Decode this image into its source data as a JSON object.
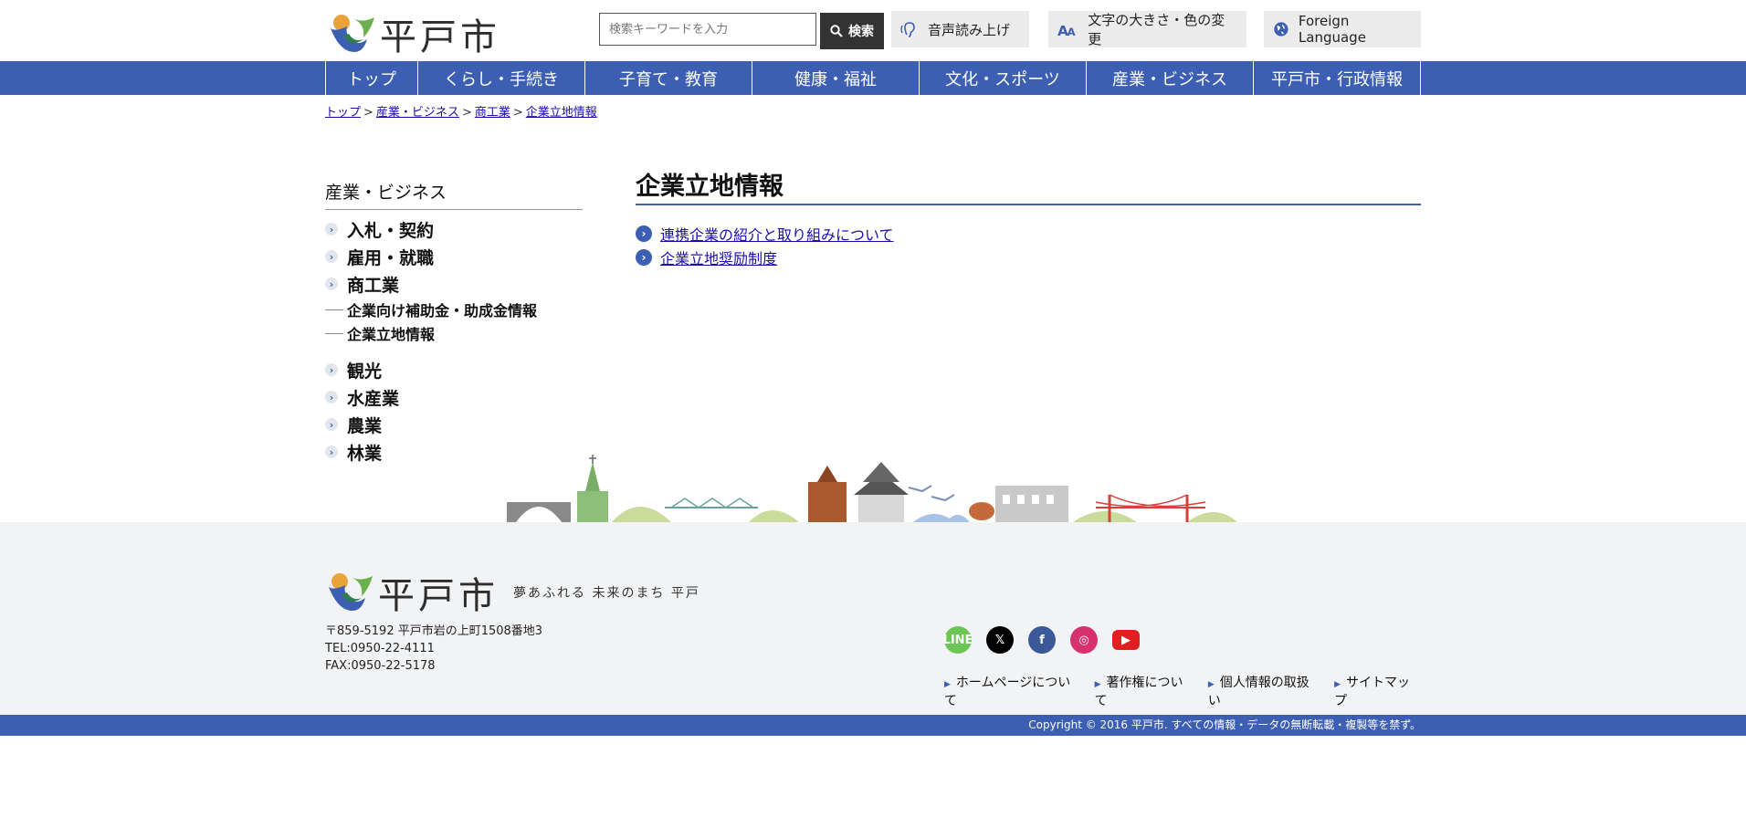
{
  "header": {
    "logo_text": "平戸市",
    "search_placeholder": "検索キーワードを入力",
    "search_button": "検索",
    "tools": {
      "voice": "音声読み上げ",
      "text_size": "文字の大きさ・色の変更",
      "language": "Foreign Language"
    }
  },
  "nav": {
    "items": [
      "トップ",
      "くらし・手続き",
      "子育て・教育",
      "健康・福祉",
      "文化・スポーツ",
      "産業・ビジネス",
      "平戸市・行政情報"
    ]
  },
  "breadcrumb": [
    "トップ",
    "産業・ビジネス",
    "商工業",
    "企業立地情報"
  ],
  "sidebar": {
    "title": "産業・ビジネス",
    "items": [
      {
        "label": "入札・契約"
      },
      {
        "label": "雇用・就職"
      },
      {
        "label": "商工業"
      },
      {
        "label": "企業向け補助金・助成金情報"
      },
      {
        "label": "企業立地情報"
      },
      {
        "label": "観光"
      },
      {
        "label": "水産業"
      },
      {
        "label": "農業"
      },
      {
        "label": "林業"
      }
    ]
  },
  "main": {
    "title": "企業立地情報",
    "links": [
      "連携企業の紹介と取り組みについて",
      "企業立地奨励制度"
    ]
  },
  "footer": {
    "logo_text": "平戸市",
    "slogan": "夢あふれる 未来のまち 平戸",
    "address": "〒859-5192 平戸市岩の上町1508番地3",
    "tel": "TEL:0950-22-4111",
    "fax": "FAX:0950-22-5178",
    "social": [
      "LINE",
      "X",
      "Facebook",
      "Instagram",
      "YouTube"
    ],
    "links": [
      "ホームページについて",
      "著作権について",
      "個人情報の取扱い",
      "サイトマップ"
    ],
    "copyright": "Copyright © 2016 平戸市. すべての情報・データの無断転載・複製等を禁ず。"
  },
  "colors": {
    "brand_blue": "#3d5fb3",
    "footer_bg": "#f2f3f5"
  }
}
